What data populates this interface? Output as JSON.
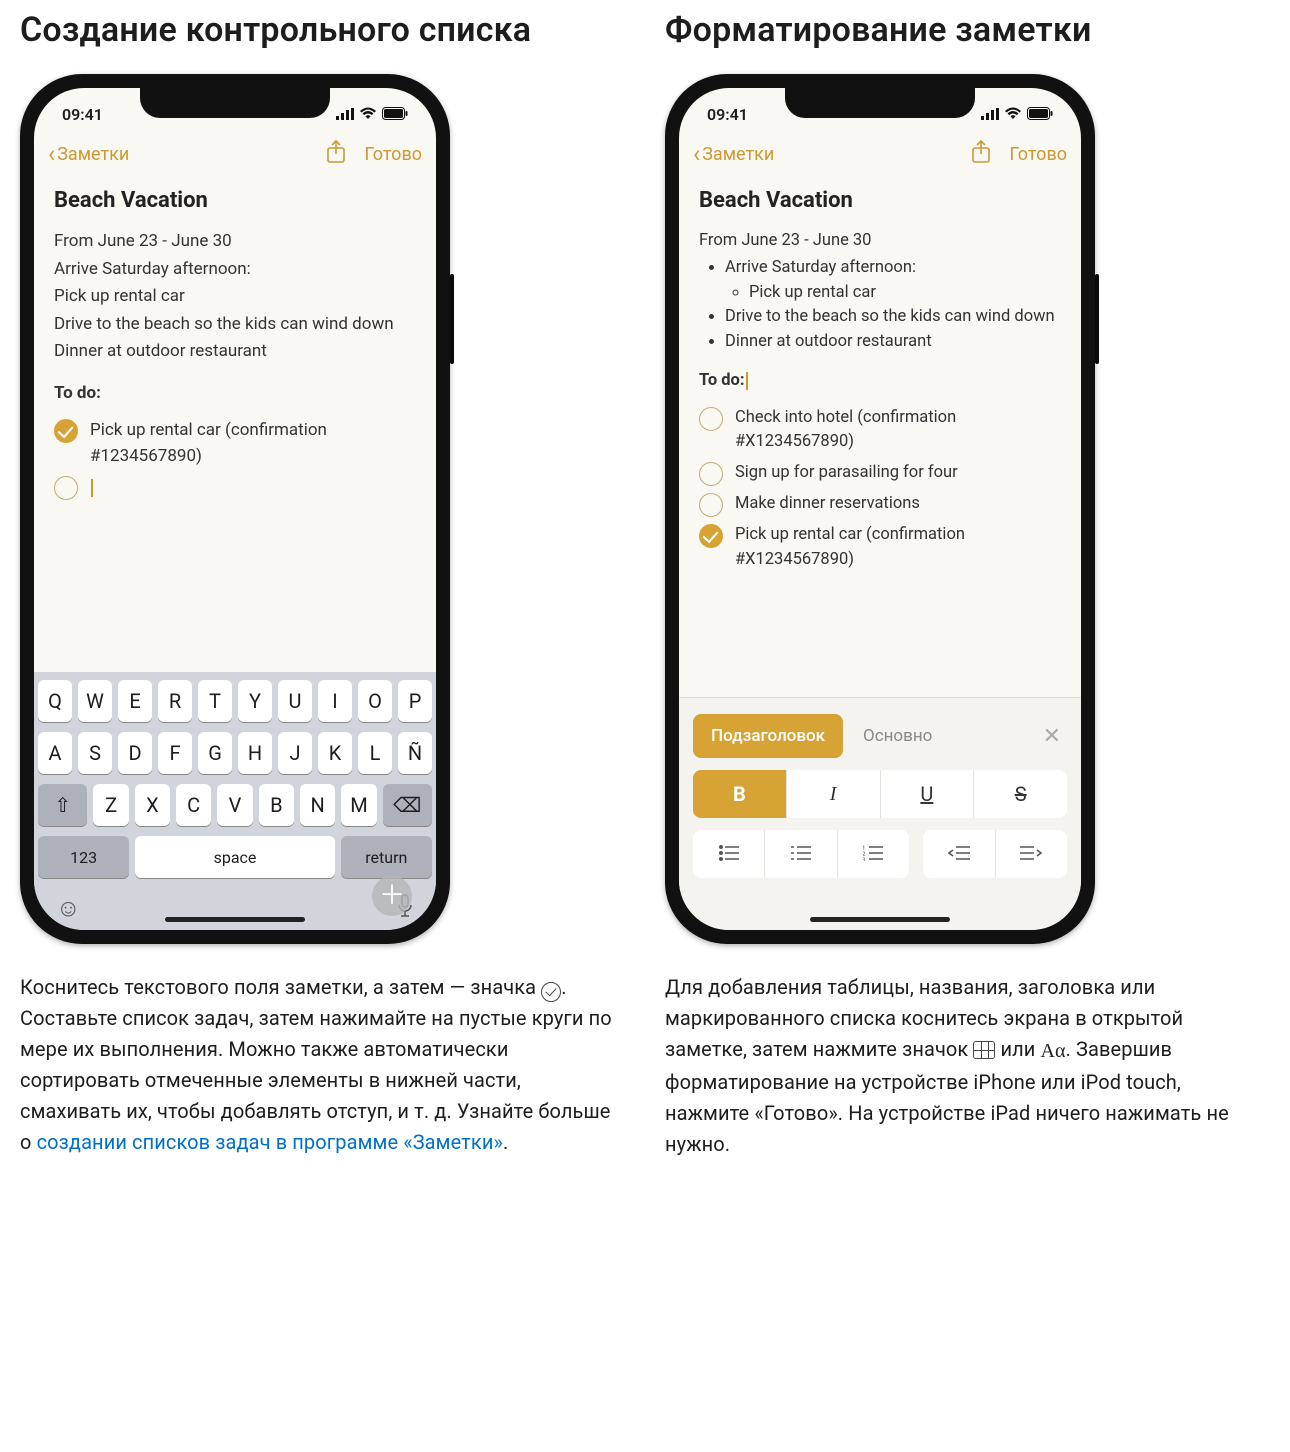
{
  "left": {
    "heading": "Создание контрольного списка",
    "status_time": "09:41",
    "nav_back": "Заметки",
    "nav_done": "Готово",
    "note_title": "Beach Vacation",
    "lines": [
      "From June 23 - June 30",
      "Arrive Saturday afternoon:",
      "Pick up rental car",
      "Drive to the beach so the kids can wind down",
      "Dinner at outdoor restaurant"
    ],
    "todo_label": "To do:",
    "todos": [
      {
        "checked": true,
        "text": "Pick up rental car (confirmation #1234567890)"
      },
      {
        "checked": false,
        "text": ""
      }
    ],
    "keyboard": {
      "row1": [
        "Q",
        "W",
        "E",
        "R",
        "T",
        "Y",
        "U",
        "I",
        "O",
        "P"
      ],
      "row2": [
        "A",
        "S",
        "D",
        "F",
        "G",
        "H",
        "J",
        "K",
        "L",
        "Ñ"
      ],
      "row3": [
        "Z",
        "X",
        "C",
        "V",
        "B",
        "N",
        "M"
      ],
      "num": "123",
      "space": "space",
      "return": "return"
    },
    "caption_a": "Коснитесь текстового поля заметки, а затем — значка ",
    "caption_b": ". Составьте список задач, затем нажимайте на пустые круги по мере их выполнения. Можно также автоматически сортировать отмеченные элементы в нижней части, смахивать их, чтобы добавлять отступ, и т. д. Узнайте больше о ",
    "caption_link": "создании списков задач в программе «Заметки»",
    "caption_c": "."
  },
  "right": {
    "heading": "Форматирование заметки",
    "status_time": "09:41",
    "nav_back": "Заметки",
    "nav_done": "Готово",
    "note_title": "Beach Vacation",
    "first_line": "From June 23 - June 30",
    "bullets": [
      {
        "text": "Arrive Saturday afternoon:",
        "sub": [
          "Pick up rental car"
        ]
      },
      {
        "text": "Drive to the beach so the kids can wind down"
      },
      {
        "text": "Dinner at outdoor restaurant"
      }
    ],
    "todo_label": "To do:",
    "todos": [
      {
        "checked": false,
        "text": "Check into hotel (confirmation #X1234567890)"
      },
      {
        "checked": false,
        "text": "Sign up for parasailing for four"
      },
      {
        "checked": false,
        "text": "Make dinner reservations"
      },
      {
        "checked": true,
        "text": "Pick up rental car (confirmation #X1234567890)"
      }
    ],
    "fmt": {
      "heading_btn": "Подзаголовок",
      "body_btn": "Основно",
      "bold": "B",
      "italic": "I",
      "underline": "U",
      "strike": "S"
    },
    "caption_a": "Для добавления таблицы, названия, заголовка или маркированного списка коснитесь экрана в открытой заметке, затем нажмите значок ",
    "caption_b": " или ",
    "caption_aa": "Aα",
    "caption_c": ". Завершив форматирование на устройстве iPhone или iPod touch, нажмите «Готово». На устройстве iPad ничего нажимать не нужно."
  }
}
